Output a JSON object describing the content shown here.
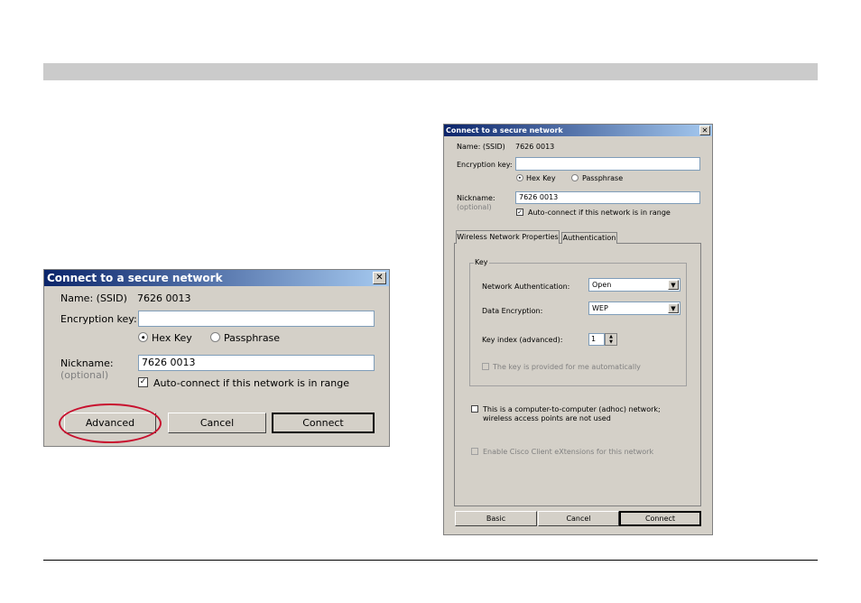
{
  "small_dialog": {
    "title": "Connect to a secure network",
    "close_glyph": "✕",
    "name_label": "Name:  (SSID)",
    "name_value": "7626 0013",
    "encryption_label": "Encryption key:",
    "encryption_value": "",
    "radio_hex": "Hex Key",
    "radio_passphrase": "Passphrase",
    "nickname_label": "Nickname:",
    "nickname_optional": "(optional)",
    "nickname_value": "7626 0013",
    "autoconnect_label": "Auto-connect if this network is in range",
    "check_glyph": "✓",
    "advanced_button": "Advanced",
    "cancel_button": "Cancel",
    "connect_button": "Connect"
  },
  "large_dialog": {
    "title": "Connect to a secure network",
    "close_glyph": "✕",
    "name_label": "Name:  (SSID)",
    "name_value": "7626 0013",
    "encryption_label": "Encryption key:",
    "encryption_value": "",
    "radio_hex": "Hex Key",
    "radio_passphrase": "Passphrase",
    "nickname_label": "Nickname:",
    "nickname_optional": "(optional)",
    "nickname_value": "7626 0013",
    "autoconnect_label": "Auto-connect if this network is in range",
    "check_glyph": "✓",
    "tab_wireless": "Wireless Network Properties",
    "tab_authentication": "Authentication",
    "key_group_label": "Key",
    "network_auth_label": "Network Authentication:",
    "network_auth_value": "Open",
    "data_encryption_label": "Data Encryption:",
    "data_encryption_value": "WEP",
    "key_index_label": "Key index (advanced):",
    "key_index_value": "1",
    "key_provided_label": "The key is provided for me automatically",
    "adhoc_label_line1": "This is a computer-to-computer (adhoc) network;",
    "adhoc_label_line2": "wireless access points are not used",
    "cisco_label": "Enable Cisco Client eXtensions for this network",
    "basic_button": "Basic",
    "cancel_button": "Cancel",
    "connect_button": "Connect",
    "dropdown_glyph": "▼",
    "spin_up": "▲",
    "spin_down": "▼"
  },
  "colors": {
    "dialog_bg": "#d4d0c8",
    "titlebar_start": "#0a246a",
    "titlebar_end": "#a6caf0",
    "highlight": "#c8102e",
    "header_bar": "#cbcbcb"
  }
}
